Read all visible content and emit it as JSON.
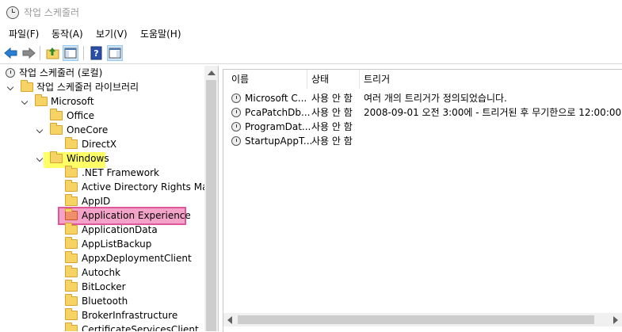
{
  "window": {
    "title": "작업 스케줄러"
  },
  "menu": [
    "파일(F)",
    "동작(A)",
    "보기(V)",
    "도움말(H)"
  ],
  "toolbar": {
    "buttons": [
      "back",
      "forward",
      "up-folder",
      "show-hide-console-tree",
      "help",
      "show-hide-action-pane"
    ]
  },
  "tree": {
    "root": "작업 스케줄러 (로컬)",
    "library": "작업 스케줄러 라이브러리",
    "microsoft": "Microsoft",
    "office": "Office",
    "onecore": "OneCore",
    "directx": "DirectX",
    "windows": "Windows",
    "windows_children": [
      ".NET Framework",
      "Active Directory Rights Mana",
      "AppID",
      "Application Experience",
      "ApplicationData",
      "AppListBackup",
      "AppxDeploymentClient",
      "Autochk",
      "BitLocker",
      "Bluetooth",
      "BrokerInfrastructure",
      "CertificateServicesClient"
    ],
    "selected": "Application Experience",
    "highlighted": "Windows"
  },
  "tasks": {
    "columns": [
      "이름",
      "상태",
      "트리거"
    ],
    "rows": [
      {
        "name": "Microsoft C...",
        "status": "사용 안 함",
        "trigger": "여러 개의 트리거가 정의되었습니다."
      },
      {
        "name": "PcaPatchDb...",
        "status": "사용 안 함",
        "trigger": "2008-09-01 오전 3:00에 - 트리거된 후 무기한으로 12:00:00"
      },
      {
        "name": "ProgramDat...",
        "status": "사용 안 함",
        "trigger": ""
      },
      {
        "name": "StartupAppT...",
        "status": "사용 안 함",
        "trigger": ""
      }
    ]
  },
  "colors": {
    "highlight_yellow": "#ffff66",
    "highlight_pink": "#f4a3c8",
    "selection_border": "#e0569a"
  }
}
